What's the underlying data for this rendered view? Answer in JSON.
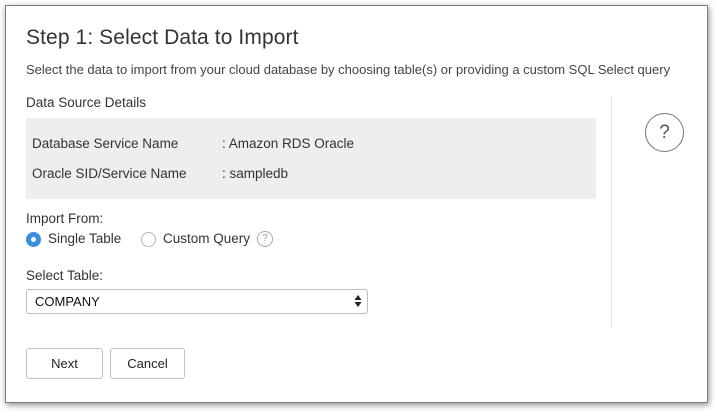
{
  "dialog": {
    "title": "Step 1: Select Data to Import",
    "subtitle": "Select the data to import from your cloud database by choosing table(s) or providing a custom SQL Select query"
  },
  "data_source": {
    "heading": "Data Source Details",
    "rows": [
      {
        "label": "Database Service Name",
        "value": ": Amazon RDS Oracle"
      },
      {
        "label": "Oracle SID/Service Name",
        "value": ": sampledb"
      }
    ]
  },
  "import_from": {
    "label": "Import From:",
    "options": [
      {
        "label": "Single Table",
        "selected": true
      },
      {
        "label": "Custom Query",
        "selected": false
      }
    ],
    "help_glyph": "?"
  },
  "select_table": {
    "label": "Select Table:",
    "value": "COMPANY"
  },
  "help": {
    "glyph": "?"
  },
  "buttons": {
    "next": "Next",
    "cancel": "Cancel"
  },
  "colors": {
    "accent": "#3b8de0",
    "panel_bg": "#eeeeee"
  },
  "icons": {
    "help_circle": "question-circle-icon",
    "select_arrows": "up-down-arrows-icon",
    "radio": "radio-button-icon"
  }
}
